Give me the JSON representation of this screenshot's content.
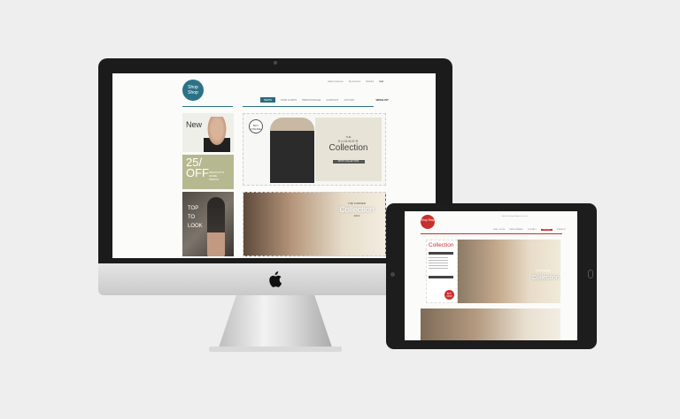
{
  "desktop": {
    "logo_text": "Shop Shop",
    "top_links": [
      "Hello Customer",
      "My Account",
      "Wishlist",
      "Cart"
    ],
    "nav": {
      "active": "NEWS",
      "items": [
        "FIND LOOKS",
        "PERSONNAGE",
        "CONTACT",
        "OUTLET"
      ],
      "right": "WISHLIST"
    },
    "tile_new": "New",
    "tile_off": {
      "num": "25/\nOFF",
      "sub": "PRODUCTS\nMORE\nPRINTS"
    },
    "tile_top": "TOP\nTO\nLOOK",
    "hero1": {
      "buy": "BUY ONLINE",
      "the": "THE",
      "summer": "SUMMER",
      "collection": "Collection",
      "button": "SHOP COLLECTION"
    },
    "hero2": {
      "small": "THE SUMMER",
      "collection": "Collection",
      "year": "2013"
    }
  },
  "tablet": {
    "logo_text": "Shop Shop",
    "top_links": "Hello Customer  My Account  Cart",
    "nav": {
      "items": [
        "FIND LOOKS",
        "PERSONNAGE",
        "CONTACT"
      ],
      "active": "OUTLET",
      "right": "WISHLIST"
    },
    "side_title": "Collection",
    "badge": "BUY NOW",
    "hero_small": "THE SUMMER",
    "hero_collection": "Collection"
  },
  "colors": {
    "desktop_accent": "#2c7287",
    "tablet_accent": "#c9302c"
  }
}
